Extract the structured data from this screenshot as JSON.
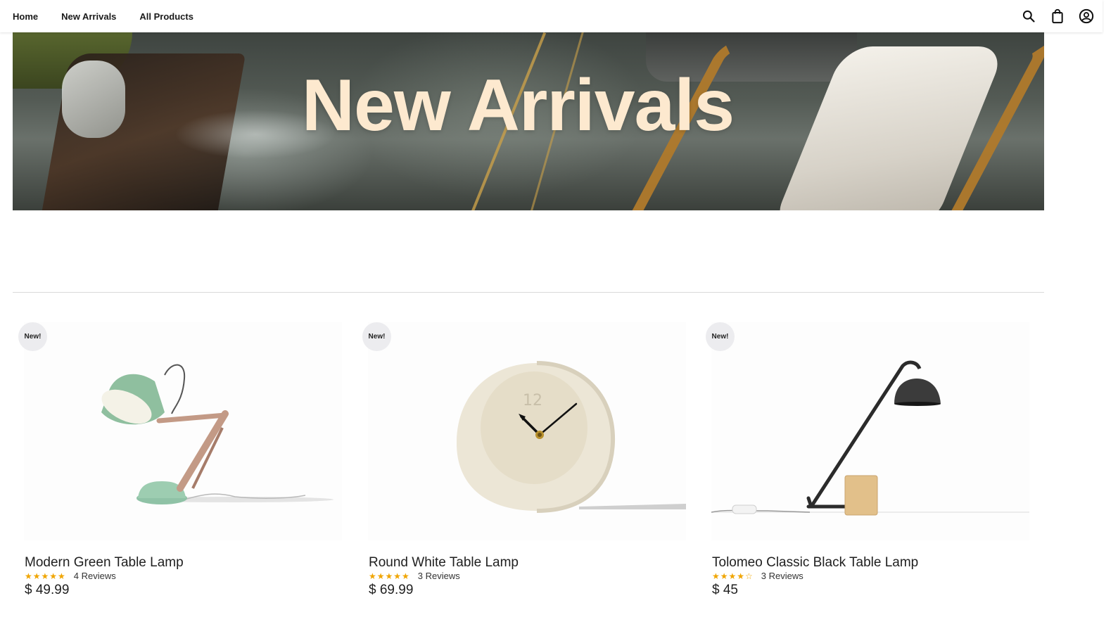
{
  "nav": {
    "items": [
      {
        "label": "Home"
      },
      {
        "label": "New Arrivals"
      },
      {
        "label": "All Products"
      }
    ],
    "icons": [
      "search-icon",
      "shopping-bag-icon",
      "account-icon"
    ]
  },
  "hero": {
    "title": "New Arrivals"
  },
  "products": [
    {
      "badge": "New!",
      "name": "Modern Green Table Lamp",
      "rating": 5,
      "stars": "★★★★★",
      "reviews": "4 Reviews",
      "price": "$ 49.99"
    },
    {
      "badge": "New!",
      "name": "Round White Table Lamp",
      "rating": 5,
      "stars": "★★★★★",
      "reviews": "3 Reviews",
      "price": "$ 69.99"
    },
    {
      "badge": "New!",
      "name": "Tolomeo Classic Black Table Lamp",
      "rating": 4,
      "stars": "★★★★☆",
      "reviews": "3 Reviews",
      "price": "$ 45"
    }
  ],
  "colors": {
    "hero_title": "#fde9cf",
    "star": "#f0a500",
    "badge_bg": "#ececef"
  }
}
